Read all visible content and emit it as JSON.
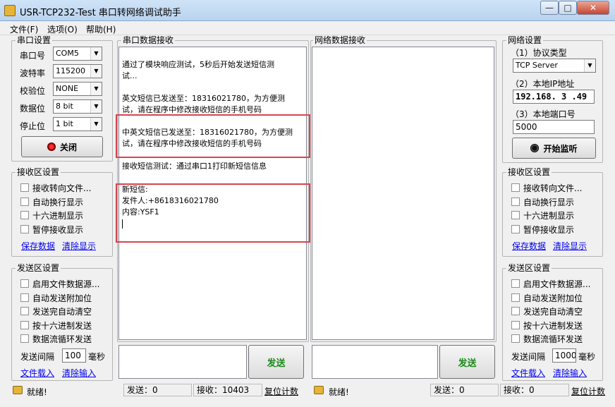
{
  "title": "USR-TCP232-Test 串口转网络调试助手",
  "window_buttons": {
    "minimize": "—",
    "maximize": "□",
    "close": "✕"
  },
  "menu": [
    "文件(F)",
    "选项(O)",
    "帮助(H)"
  ],
  "serial_settings": {
    "title": "串口设置",
    "port_label": "串口号",
    "port_value": "COM5",
    "baud_label": "波特率",
    "baud_value": "115200",
    "parity_label": "校验位",
    "parity_value": "NONE",
    "databits_label": "数据位",
    "databits_value": "8 bit",
    "stopbits_label": "停止位",
    "stopbits_value": "1 bit",
    "close_button": "关闭"
  },
  "serial_receive": {
    "title": "串口数据接收",
    "lines": [
      "通过了模块响应测试，5秒后开始发送短信测",
      "试...",
      "",
      "英文短信已发送至：18316021780，为方便测",
      "试，请在程序中修改接收短信的手机号码",
      "",
      "中英文短信已发送至：18316021780，为方便测",
      "试，请在程序中修改接收短信的手机号码",
      "",
      "接收短信测试：通过串口1打印新短信信息",
      "",
      "新短信:",
      "发件人:+8618316021780",
      "内容:YSF1"
    ]
  },
  "net_receive": {
    "title": "网络数据接收"
  },
  "net_settings": {
    "title": "网络设置",
    "protocol_label": "（1）协议类型",
    "protocol_value": "TCP Server",
    "ip_label": "（2）本地IP地址",
    "ip_value": "192.168. 3 .49",
    "port_label": "（3）本地端口号",
    "port_value": "5000",
    "listen_button": "开始监听"
  },
  "recv_settings_left": {
    "title": "接收区设置",
    "options": [
      "接收转向文件...",
      "自动换行显示",
      "十六进制显示",
      "暂停接收显示"
    ],
    "save_link": "保存数据",
    "clear_link": "清除显示"
  },
  "recv_settings_right": {
    "title": "接收区设置",
    "options": [
      "接收转向文件...",
      "自动换行显示",
      "十六进制显示",
      "暂停接收显示"
    ],
    "save_link": "保存数据",
    "clear_link": "清除显示"
  },
  "send_settings_left": {
    "title": "发送区设置",
    "options": [
      "启用文件数据源...",
      "自动发送附加位",
      "发送完自动清空",
      "按十六进制发送",
      "数据流循环发送"
    ],
    "interval_label": "发送间隔",
    "interval_value": "100",
    "interval_unit": "毫秒",
    "load_link": "文件载入",
    "clear_link": "清除输入"
  },
  "send_settings_right": {
    "title": "发送区设置",
    "options": [
      "启用文件数据源...",
      "自动发送附加位",
      "发送完自动清空",
      "按十六进制发送",
      "数据流循环发送"
    ],
    "interval_label": "发送间隔",
    "interval_value": "1000",
    "interval_unit": "毫秒",
    "load_link": "文件载入",
    "clear_link": "清除输入"
  },
  "send_button_left": "发送",
  "send_button_right": "发送",
  "status_left": {
    "ready": "就绪!",
    "sent": "发送：0",
    "received": "接收：10403",
    "reset": "复位计数"
  },
  "status_right": {
    "ready": "就绪!",
    "sent": "发送：0",
    "received": "接收：0",
    "reset": "复位计数"
  },
  "colors": {
    "accent_red": "#d9434f",
    "send_green": "#1a8a1a",
    "link_blue": "#0000ee"
  }
}
